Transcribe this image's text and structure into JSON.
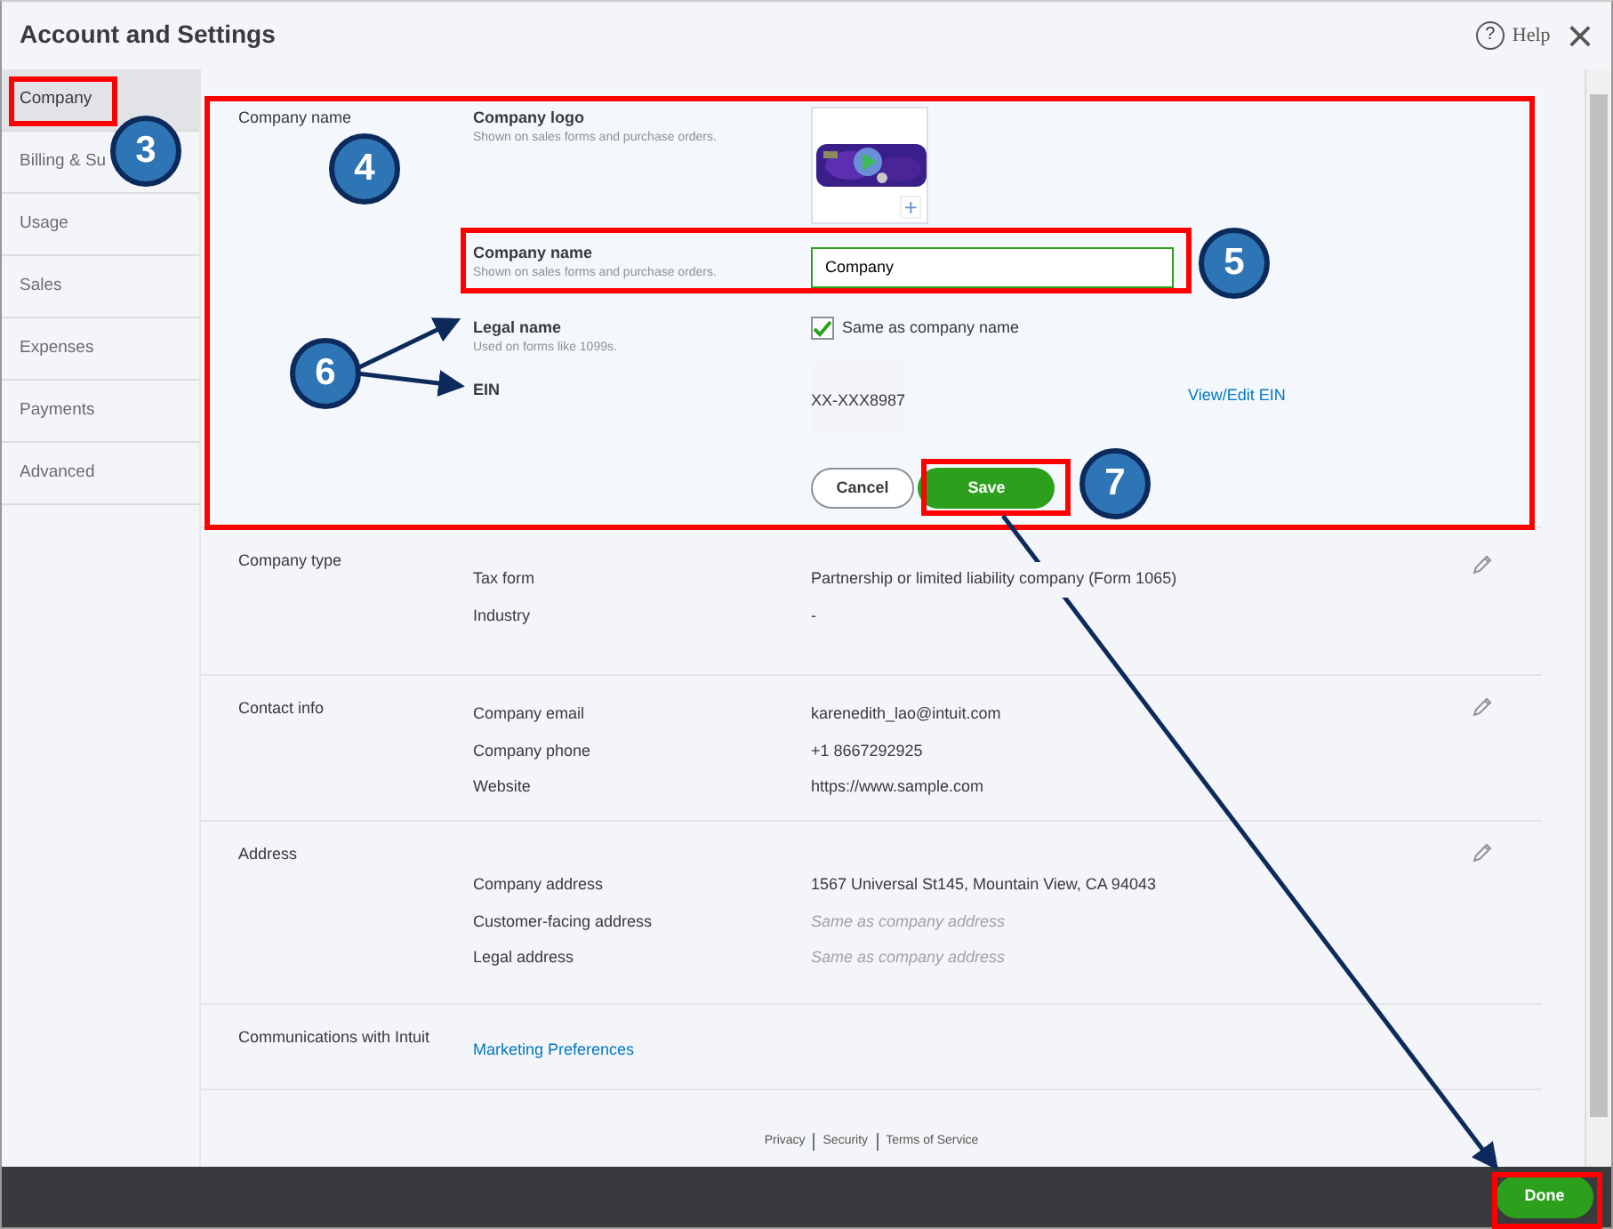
{
  "window": {
    "title": "Account and Settings",
    "help_icon": "?",
    "help": "Help",
    "close": "×"
  },
  "sidebar": {
    "items": [
      {
        "label": "Company",
        "selected": true
      },
      {
        "label": "Billing & Su",
        "selected": false
      },
      {
        "label": "Usage",
        "selected": false
      },
      {
        "label": "Sales",
        "selected": false
      },
      {
        "label": "Expenses",
        "selected": false
      },
      {
        "label": "Payments",
        "selected": false
      },
      {
        "label": "Advanced",
        "selected": false
      }
    ]
  },
  "company_name_section": {
    "title": "Company name",
    "logo": {
      "label": "Company logo",
      "hint": "Shown on sales forms and purchase orders.",
      "add": "+"
    },
    "name_field": {
      "label": "Company name",
      "hint": "Shown on sales forms and purchase orders.",
      "value": "Company"
    },
    "legal_name": {
      "label": "Legal name",
      "hint": "Used on forms like 1099s.",
      "checkbox": {
        "label": "Same as company name",
        "checked": true
      }
    },
    "ein": {
      "label": "EIN",
      "value": "XX-XXX8987",
      "link": "View/Edit EIN"
    },
    "buttons": [
      {
        "label": "Cancel",
        "kind": "secondary"
      },
      {
        "label": "Save",
        "kind": "primary"
      }
    ]
  },
  "sections": [
    {
      "title": "Company type",
      "editable": true,
      "rows": [
        {
          "label": "Tax form",
          "value": "Partnership or limited liability company (Form 1065)",
          "kind": "text"
        },
        {
          "label": "Industry",
          "value": "-",
          "kind": "text"
        }
      ]
    },
    {
      "title": "Contact info",
      "editable": true,
      "rows": [
        {
          "label": "Company email",
          "value": "karenedith_lao@intuit.com",
          "kind": "text"
        },
        {
          "label": "Company phone",
          "value": "+1 8667292925",
          "kind": "text"
        },
        {
          "label": "Website",
          "value": "https://www.sample.com",
          "kind": "text"
        }
      ]
    },
    {
      "title": "Address",
      "editable": true,
      "rows": [
        {
          "label": "Company address",
          "value": "1567 Universal St145, Mountain View, CA 94043",
          "kind": "text"
        },
        {
          "label": "Customer-facing address",
          "value": "Same as company address",
          "kind": "muted"
        },
        {
          "label": "Legal address",
          "value": "Same as company address",
          "kind": "muted"
        }
      ]
    },
    {
      "title": "Communications with Intuit",
      "editable": false,
      "rows": [
        {
          "label": "Marketing Preferences",
          "kind": "link"
        }
      ]
    }
  ],
  "footer_links": [
    "Privacy",
    "Security",
    "Terms of Service"
  ],
  "done_button": "Done",
  "callouts": [
    "3",
    "4",
    "5",
    "6",
    "7"
  ]
}
